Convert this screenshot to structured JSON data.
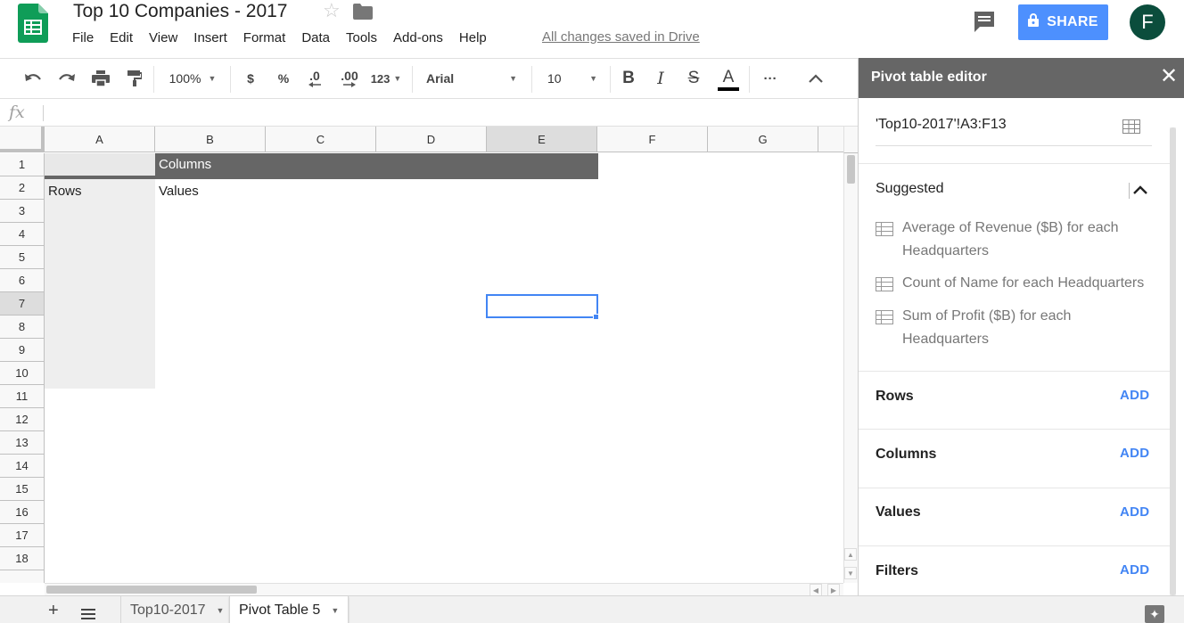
{
  "app": {
    "doc_title": "Top 10 Companies - 2017",
    "saved_status": "All changes saved in Drive",
    "share_label": "SHARE",
    "avatar_initial": "F",
    "accent_color": "#4d90fe"
  },
  "menu": [
    "File",
    "Edit",
    "View",
    "Insert",
    "Format",
    "Data",
    "Tools",
    "Add-ons",
    "Help"
  ],
  "toolbar": {
    "zoom": "100%",
    "currency": "$",
    "percent": "%",
    "decrease_decimal": ".0",
    "increase_decimal": ".00",
    "more_formats": "123",
    "font_name": "Arial",
    "font_size": "10",
    "bold": "B",
    "italic": "I",
    "strike": "S",
    "text_color": "A",
    "more": "···"
  },
  "formula_bar": {
    "label": "fx",
    "value": ""
  },
  "grid": {
    "columns": [
      "A",
      "B",
      "C",
      "D",
      "E",
      "F",
      "G"
    ],
    "selected_column": "E",
    "rows": [
      "1",
      "2",
      "3",
      "4",
      "5",
      "6",
      "7",
      "8",
      "9",
      "10",
      "11",
      "12",
      "13",
      "14",
      "15",
      "16",
      "17",
      "18"
    ],
    "selected_row": "7",
    "cells": {
      "B1": "Columns",
      "A2": "Rows",
      "B2": "Values"
    }
  },
  "sheets": {
    "tabs": [
      {
        "label": "Top10-2017",
        "active": false
      },
      {
        "label": "Pivot Table 5",
        "active": true
      }
    ]
  },
  "pivot_editor": {
    "title": "Pivot table editor",
    "range": "'Top10-2017'!A3:F13",
    "suggested_label": "Suggested",
    "suggestions": [
      "Average of Revenue ($B) for each Headquarters",
      "Count of Name for each Headquarters",
      "Sum of Profit ($B) for each Headquarters"
    ],
    "sections": [
      {
        "label": "Rows",
        "action": "ADD"
      },
      {
        "label": "Columns",
        "action": "ADD"
      },
      {
        "label": "Values",
        "action": "ADD"
      },
      {
        "label": "Filters",
        "action": "ADD"
      }
    ]
  }
}
